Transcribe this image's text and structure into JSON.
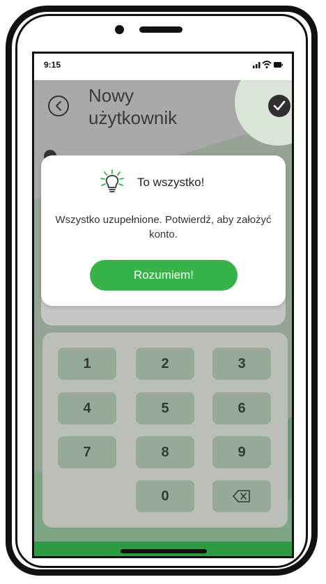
{
  "status_bar": {
    "time": "9:15",
    "icons": [
      "signal-icon",
      "wifi-icon",
      "battery-icon"
    ]
  },
  "header": {
    "back_icon": "chevron-left-icon",
    "title": "Nowy użytkownik",
    "confirm_icon": "check-icon"
  },
  "dialog": {
    "icon": "lightbulb-icon",
    "title": "To wszystko!",
    "message": "Wszystko uzupełnione. Potwierdź, aby założyć konto.",
    "button_label": "Rozumiem!"
  },
  "keypad": {
    "keys": [
      "1",
      "2",
      "3",
      "4",
      "5",
      "6",
      "7",
      "8",
      "9",
      "0"
    ],
    "delete_icon": "backspace-icon"
  },
  "colors": {
    "accent_green": "#37b34a",
    "dark_green": "#2e9a42",
    "overlay_gray": "#a9a9a9",
    "key_fill": "#97aa99"
  }
}
